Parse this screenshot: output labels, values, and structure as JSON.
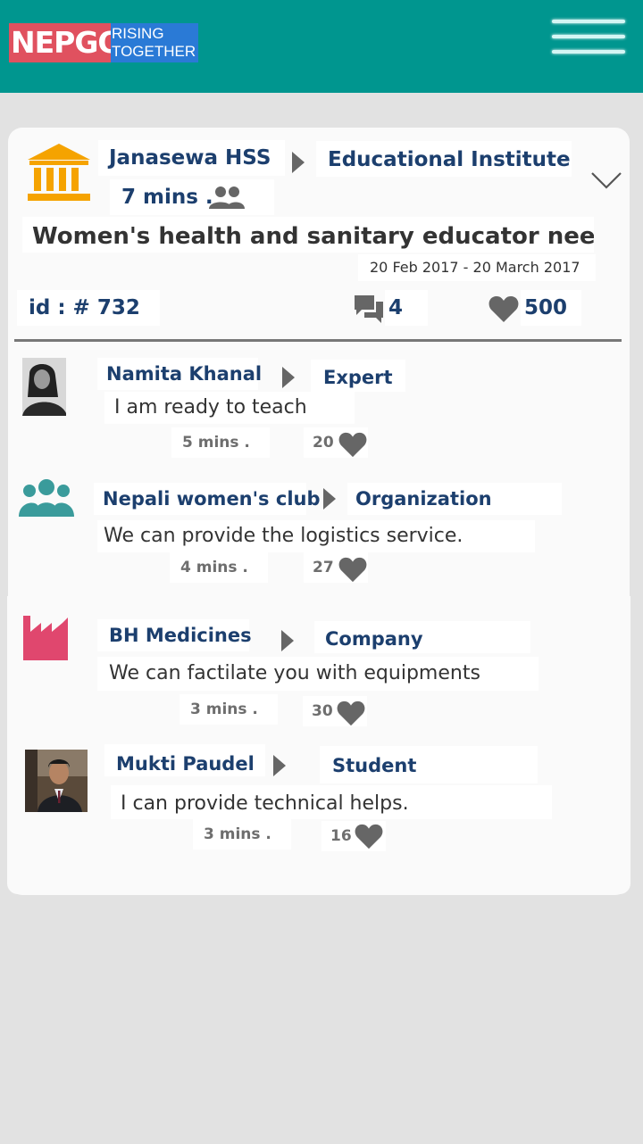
{
  "app": {
    "logo_main": "NEPGO",
    "logo_tag_line1": "RISING",
    "logo_tag_line2": "TOGETHER"
  },
  "post": {
    "institution": "Janasewa HSS",
    "category": "Educational Institute",
    "time": "7 mins .",
    "title": "Women's health and sanitary educator needed",
    "date_range": "20 Feb 2017 - 20 March 2017",
    "id_label": "id : # 732",
    "comments_count": "4",
    "likes_count": "500"
  },
  "comments": [
    {
      "name": "Namita Khanal",
      "role": "Expert",
      "text": "I am ready to teach",
      "time": "5 mins .",
      "likes": "20",
      "avatar_icon": "user-photo"
    },
    {
      "name": "Nepali women's club",
      "role": "Organization",
      "text": "We can provide the logistics service.",
      "time": "4 mins .",
      "likes": "27",
      "avatar_icon": "group-icon"
    },
    {
      "name": "BH Medicines",
      "role": "Company",
      "text": "We can factilate you with equipments",
      "time": "3 mins .",
      "likes": "30",
      "avatar_icon": "factory-icon"
    },
    {
      "name": "Mukti Paudel",
      "role": "Student",
      "text": "I can provide technical helps.",
      "time": "3 mins .",
      "likes": "16",
      "avatar_icon": "user-photo"
    }
  ],
  "colors": {
    "topbar": "#00968f",
    "logo_red": "#e0515f",
    "logo_blue": "#2a7ad6",
    "navy_text": "#1c3f6e",
    "institution_icon": "#f5a300",
    "group_icon": "#3a9b9b",
    "factory_icon": "#e0476e"
  }
}
